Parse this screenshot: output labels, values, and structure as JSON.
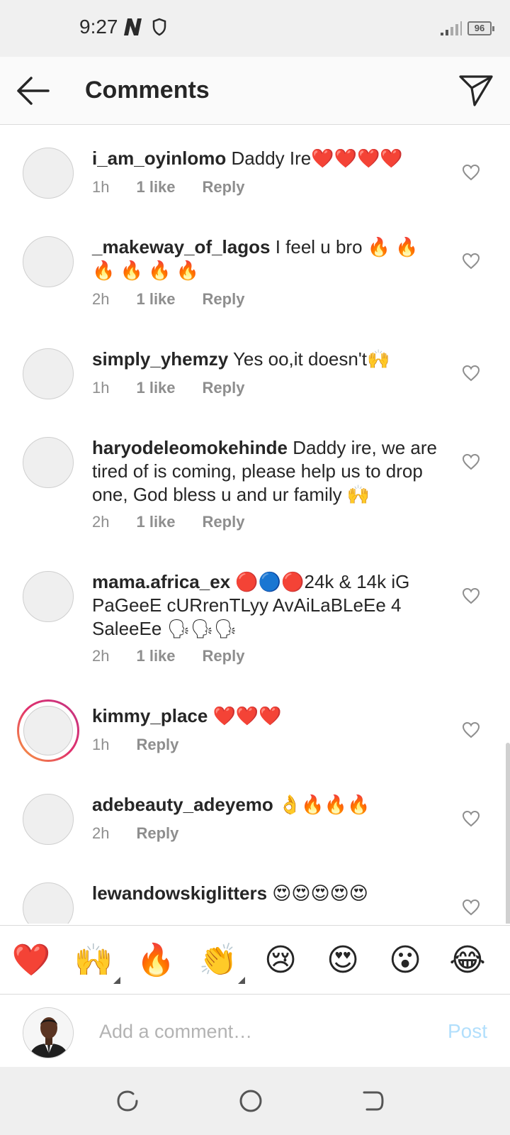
{
  "status": {
    "time": "9:27",
    "battery": "96"
  },
  "header": {
    "title": "Comments"
  },
  "comments": [
    {
      "user": "i_am_oyinlomo",
      "text": " Daddy Ire❤️❤️❤️❤️",
      "time": "1h",
      "likes": "1 like",
      "reply": "Reply"
    },
    {
      "user": "_makeway_of_lagos",
      "text": " I feel u bro 🔥 🔥 🔥 🔥 🔥 🔥",
      "time": "2h",
      "likes": "1 like",
      "reply": "Reply"
    },
    {
      "user": "simply_yhemzy",
      "text": " Yes oo,it doesn't🙌",
      "time": "1h",
      "likes": "1 like",
      "reply": "Reply"
    },
    {
      "user": "haryodeleomokehinde",
      "text": " Daddy ire, we are tired of is coming, please help us to drop one, God bless u and ur family 🙌",
      "time": "2h",
      "likes": "1 like",
      "reply": "Reply"
    },
    {
      "user": "mama.africa_ex",
      "text": " 🔴🔵🔴24k & 14k iG PaGeeE cURrenTLyy AvAiLaBLeEe   4 SaleeEe                       🗣🗣🗣",
      "time": "2h",
      "likes": "1 like",
      "reply": "Reply"
    },
    {
      "user": "kimmy_place",
      "text": " ❤️❤️❤️",
      "time": "1h",
      "reply": "Reply"
    },
    {
      "user": "adebeauty_adeyemo",
      "text": " 👌🔥🔥🔥",
      "time": "2h",
      "reply": "Reply"
    },
    {
      "user": "lewandowskiglitters",
      "text": " 😍😍😍😍😍"
    }
  ],
  "emoji_bar": [
    "❤️",
    "🙌",
    "🔥",
    "👏",
    "😢",
    "😍",
    "😮",
    "😂"
  ],
  "input": {
    "placeholder": "Add a comment…",
    "post_label": "Post"
  },
  "icons": {
    "back": "arrow-left-icon",
    "send": "paper-plane-icon",
    "like": "heart-outline-icon",
    "nav_recents": "recents-icon",
    "nav_home": "home-icon",
    "nav_back": "back-icon"
  },
  "colors": {
    "post_disabled": "#b2dffc",
    "meta_gray": "#8e8e8e",
    "text": "#262626"
  }
}
